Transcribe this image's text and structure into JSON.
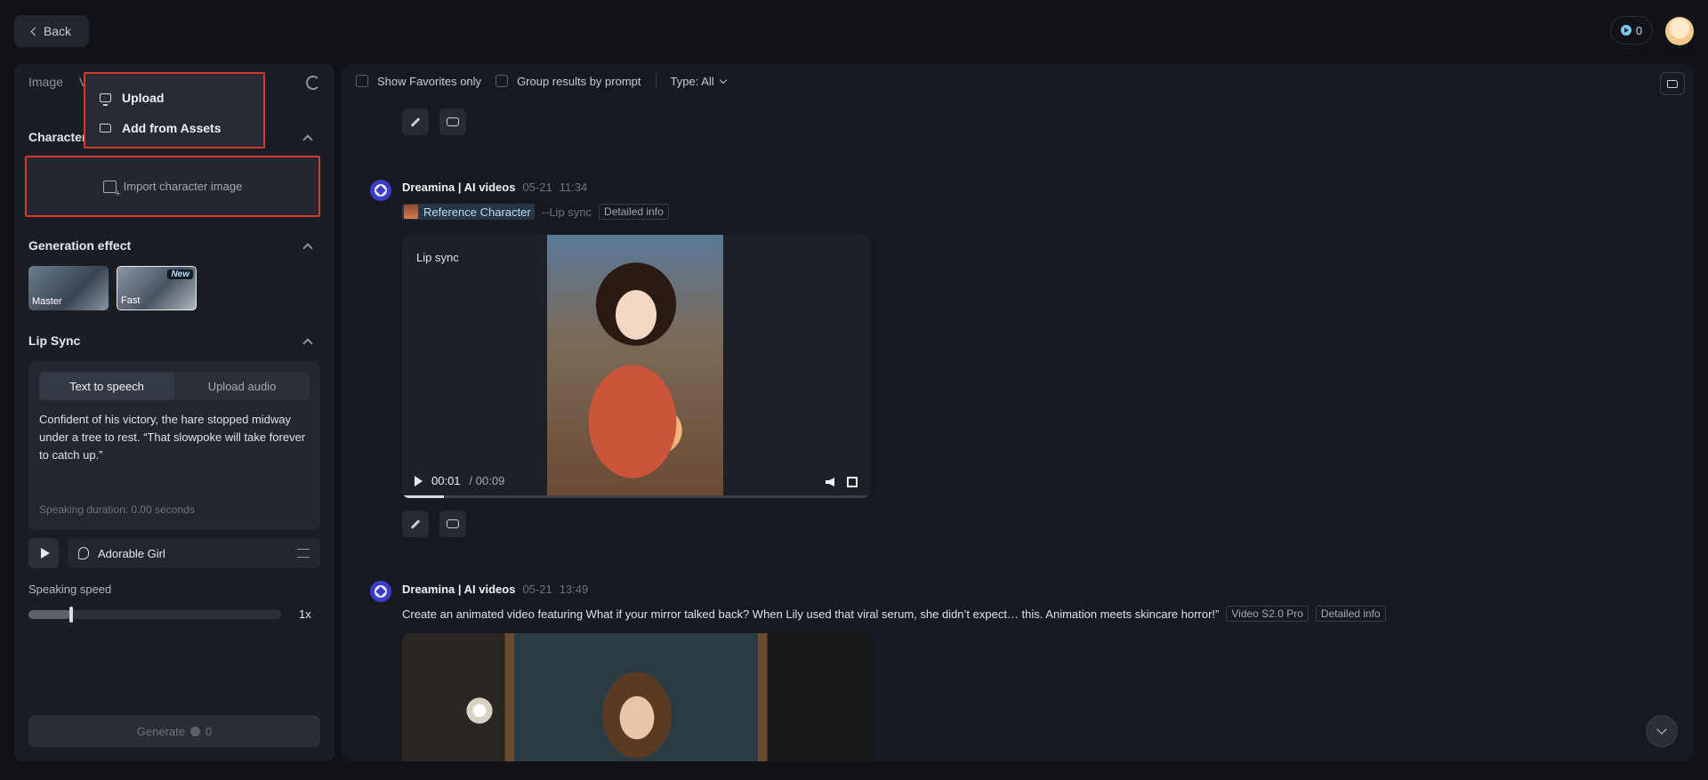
{
  "header": {
    "back_label": "Back",
    "credits": "0"
  },
  "left_panel": {
    "tabs": [
      "Image",
      "V"
    ],
    "character_title": "Character",
    "import_label": "Import character image",
    "dropdown": {
      "upload": "Upload",
      "add_from_assets": "Add from Assets"
    },
    "generation_effect_title": "Generation effect",
    "effects": [
      {
        "label": "Master"
      },
      {
        "label": "Fast",
        "badge": "New"
      }
    ],
    "lip_sync_title": "Lip Sync",
    "segment": {
      "text_to_speech": "Text to speech",
      "upload_audio": "Upload audio"
    },
    "tts_text": "Confident of his victory, the hare stopped midway under a tree to rest. “That slowpoke will take forever to catch up.”",
    "speaking_duration": "Speaking duration: 0.00 seconds",
    "voice_name": "Adorable Girl",
    "speaking_speed_label": "Speaking speed",
    "speed_value": "1x",
    "speed_fraction": 0.17,
    "generate_label": "Generate",
    "generate_cost": "0"
  },
  "toolbar": {
    "show_favorites": "Show Favorites only",
    "group_results": "Group results by prompt",
    "type_filter": "Type: All"
  },
  "feed": {
    "item1": {
      "name": "Dreamina | AI videos",
      "date": "05-21",
      "time": "11:34",
      "ref_character": "Reference Character",
      "mode": "--Lip sync",
      "detail": "Detailed info",
      "video_label": "Lip sync",
      "current_time": "00:01",
      "total_time": "/ 00:09",
      "progress": 0.09
    },
    "item2": {
      "name": "Dreamina | AI videos",
      "date": "05-21",
      "time": "13:49",
      "prompt": "Create an animated video featuring What if your mirror talked back? When Lily used that viral serum, she didn’t expect… this. Animation meets skincare horror!”",
      "model_tag": "Video S2.0 Pro",
      "detail": "Detailed info"
    }
  },
  "icons": {
    "back": "chevron-left-icon",
    "refresh": "refresh-icon",
    "upload": "monitor-icon",
    "assets": "folder-icon",
    "import": "image-plus-icon",
    "edit": "pencil-icon",
    "regenerate": "regenerate-icon",
    "scroll": "chevron-down-icon"
  },
  "colors": {
    "highlight_border": "#d13b2f",
    "bot_avatar": "#3a3ec4",
    "credit_accent": "#7fc8ee"
  }
}
